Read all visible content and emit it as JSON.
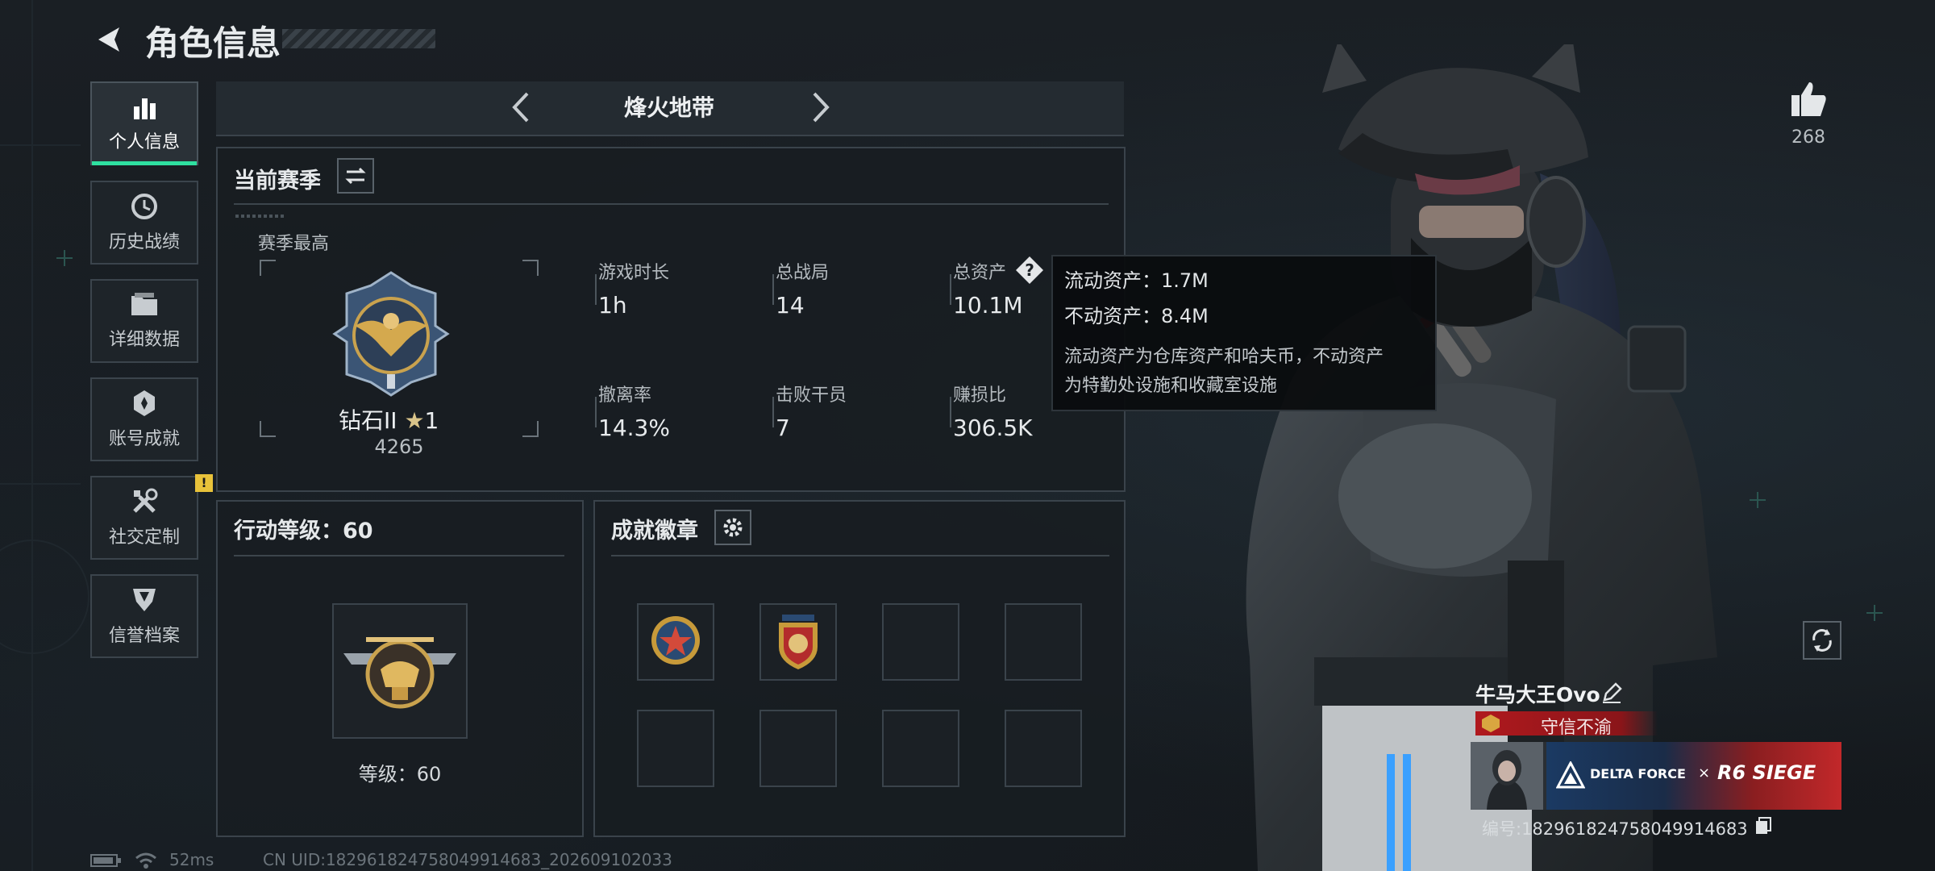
{
  "header": {
    "title": "角色信息"
  },
  "sidebar": {
    "items": [
      {
        "label": "个人信息",
        "icon": "bar-chart-icon",
        "active": true
      },
      {
        "label": "历史战绩",
        "icon": "clock-history-icon"
      },
      {
        "label": "详细数据",
        "icon": "folder-icon"
      },
      {
        "label": "账号成就",
        "icon": "achievement-icon"
      },
      {
        "label": "社交定制",
        "icon": "tools-icon",
        "badge": "!"
      },
      {
        "label": "信誉档案",
        "icon": "shield-icon"
      }
    ]
  },
  "mode_selector": {
    "label": "烽火地带"
  },
  "season": {
    "title": "当前赛季",
    "best_label": "赛季最高",
    "rank_name": "钻石II",
    "rank_stars": "1",
    "rank_score": "4265",
    "stats": [
      {
        "label": "游戏时长",
        "value": "1h"
      },
      {
        "label": "总战局",
        "value": "14"
      },
      {
        "label": "总资产",
        "value": "10.1M"
      },
      {
        "label": "撤离率",
        "value": "14.3%"
      },
      {
        "label": "击败干员",
        "value": "7"
      },
      {
        "label": "赚损比",
        "value": "306.5K"
      }
    ]
  },
  "tooltip": {
    "liquid": "流动资产：1.7M",
    "fixed": "不动资产：8.4M",
    "desc_line1": "流动资产为仓库资产和哈夫币，不动资产",
    "desc_line2": "为特勤处设施和收藏室设施"
  },
  "action_level": {
    "title": "行动等级：60",
    "level_text": "等级：60"
  },
  "badges": {
    "title": "成就徽章",
    "filled_count": 2,
    "total_slots": 8
  },
  "likes": {
    "count": "268"
  },
  "player": {
    "name": "牛马大王Ovo",
    "title": "守信不渝",
    "banner_brand1": "DELTA FORCE",
    "banner_sep": "×",
    "banner_brand2": "R6 SIEGE",
    "id_text": "编号:1829618247580499146"
  },
  "status_bar": {
    "ping": "52ms",
    "uid": "CN UID:1829618247580499146​83_202609102033"
  },
  "colors": {
    "accent": "#2fe0a0",
    "title_red": "#b0191e",
    "warn": "#e8c23a"
  }
}
